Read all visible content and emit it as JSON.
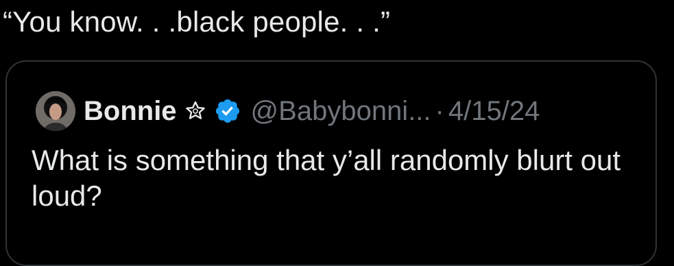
{
  "post": {
    "text": "“You know. . .black people. . .”"
  },
  "quoted_post": {
    "display_name": "Bonnie",
    "name_emoji_icon": "star-icon",
    "verified_icon": "verified-badge-icon",
    "handle": "@Babybonni...",
    "separator": "·",
    "date": "4/15/24",
    "text": "What is something that y’all randomly blurt out loud?"
  },
  "colors": {
    "background": "#000000",
    "primary_text": "#e7e9ea",
    "secondary_text": "#71767b",
    "border": "#2f3336",
    "verified_blue": "#1d9bf0"
  }
}
